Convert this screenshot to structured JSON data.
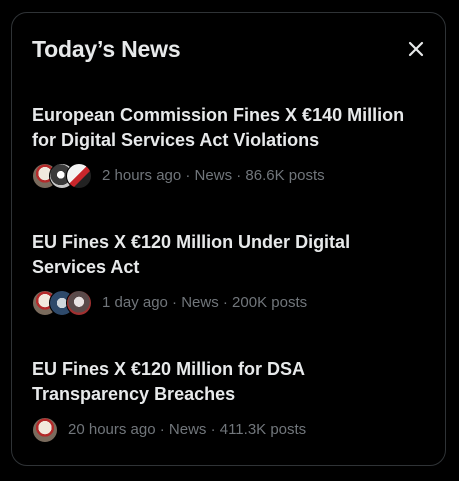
{
  "header": {
    "title": "Today’s News"
  },
  "news": [
    {
      "headline": "European Commission Fines X €140 Million for Digital Services Act Violations",
      "meta": "2 hours ago · News · 86.6K posts"
    },
    {
      "headline": "EU Fines X €120 Million Under Digital Services Act",
      "meta": "1 day ago · News · 200K posts"
    },
    {
      "headline": "EU Fines X €120 Million for DSA Transparency Breaches",
      "meta": "20 hours ago · News · 411.3K posts"
    }
  ],
  "icons": {
    "close": "close-icon"
  },
  "colors": {
    "background": "#000000",
    "border": "#2f3336",
    "text_primary": "#e7e9ea",
    "text_secondary": "#71767b"
  }
}
